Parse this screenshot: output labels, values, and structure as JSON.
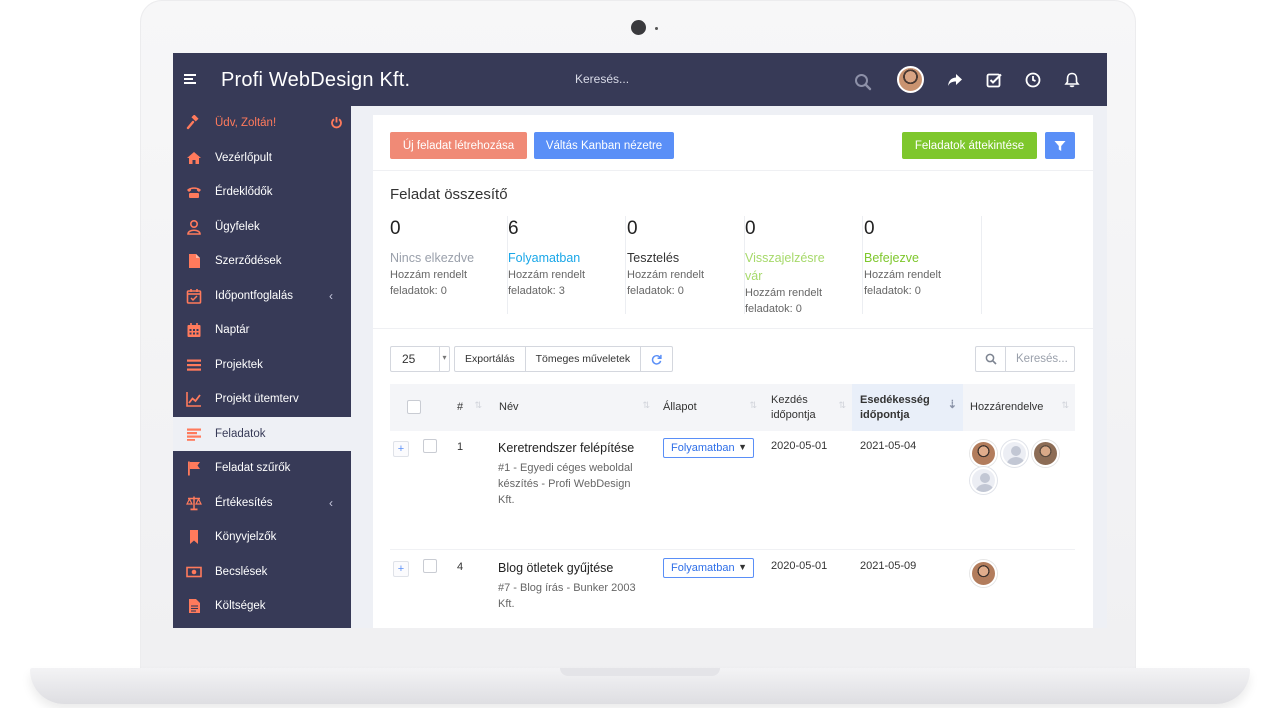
{
  "app": {
    "title": "Profi WebDesign Kft.",
    "search_placeholder": "Keresés..."
  },
  "sidebar": {
    "greeting": "Üdv, Zoltán!",
    "items": [
      {
        "label": "Vezérlőpult",
        "icon": "home-icon"
      },
      {
        "label": "Érdeklődők",
        "icon": "phone-icon"
      },
      {
        "label": "Ügyfelek",
        "icon": "user-icon"
      },
      {
        "label": "Szerződések",
        "icon": "file-icon"
      },
      {
        "label": "Időpontfoglalás",
        "icon": "calendar-check-icon",
        "has_submenu": true
      },
      {
        "label": "Naptár",
        "icon": "calendar-icon"
      },
      {
        "label": "Projektek",
        "icon": "bars-icon"
      },
      {
        "label": "Projekt ütemterv",
        "icon": "chart-line-icon"
      },
      {
        "label": "Feladatok",
        "icon": "tasks-icon",
        "active": true
      },
      {
        "label": "Feladat szűrők",
        "icon": "flag-icon"
      },
      {
        "label": "Értékesítés",
        "icon": "balance-scale-icon",
        "has_submenu": true
      },
      {
        "label": "Könyvjelzők",
        "icon": "bookmark-icon"
      },
      {
        "label": "Becslések",
        "icon": "money-icon"
      },
      {
        "label": "Költségek",
        "icon": "file-text-icon"
      }
    ]
  },
  "actions": {
    "new_task": "Új feladat létrehozása",
    "kanban": "Váltás Kanban nézetre",
    "overview": "Feladatok áttekintése"
  },
  "summary": {
    "title": "Feladat összesítő",
    "stats": [
      {
        "count": "0",
        "name": "Nincs elkezdve",
        "desc": "Hozzám rendelt feladatok: 0",
        "color": "#9aa0ab"
      },
      {
        "count": "6",
        "name": "Folyamatban",
        "desc": "Hozzám rendelt feladatok: 3",
        "color": "#1aa7e8"
      },
      {
        "count": "0",
        "name": "Tesztelés",
        "desc": "Hozzám rendelt feladatok: 0",
        "color": "#333333"
      },
      {
        "count": "0",
        "name": "Visszajelzésre vár",
        "desc": "Hozzám rendelt feladatok: 0",
        "color": "#a6d96a"
      },
      {
        "count": "0",
        "name": "Befejezve",
        "desc": "Hozzám rendelt feladatok: 0",
        "color": "#7ec72c"
      }
    ]
  },
  "table_toolbar": {
    "page_length": "25",
    "export": "Exportálás",
    "bulk": "Tömeges műveletek",
    "search_placeholder": "Keresés..."
  },
  "table": {
    "headers": {
      "num": "#",
      "name": "Név",
      "status": "Állapot",
      "start": "Kezdés időpontja",
      "due": "Esedékesség időpontja",
      "assigned": "Hozzárendelve"
    },
    "rows": [
      {
        "id": "1",
        "name": "Keretrendszer felépítése",
        "project": "#1 - Egyedi céges weboldal készítés - Profi WebDesign Kft.",
        "status": "Folyamatban",
        "start": "2020-05-01",
        "due": "2021-05-04"
      },
      {
        "id": "4",
        "name": "Blog ötletek gyűjtése",
        "project": "#7 - Blog írás - Bunker 2003 Kft.",
        "status": "Folyamatban",
        "start": "2020-05-01",
        "due": "2021-05-09"
      }
    ]
  },
  "colors": {
    "sidebar_bg": "#373a57",
    "accent_red": "#f08a76",
    "accent_blue": "#5a8ff7",
    "accent_green": "#7ec72c"
  }
}
